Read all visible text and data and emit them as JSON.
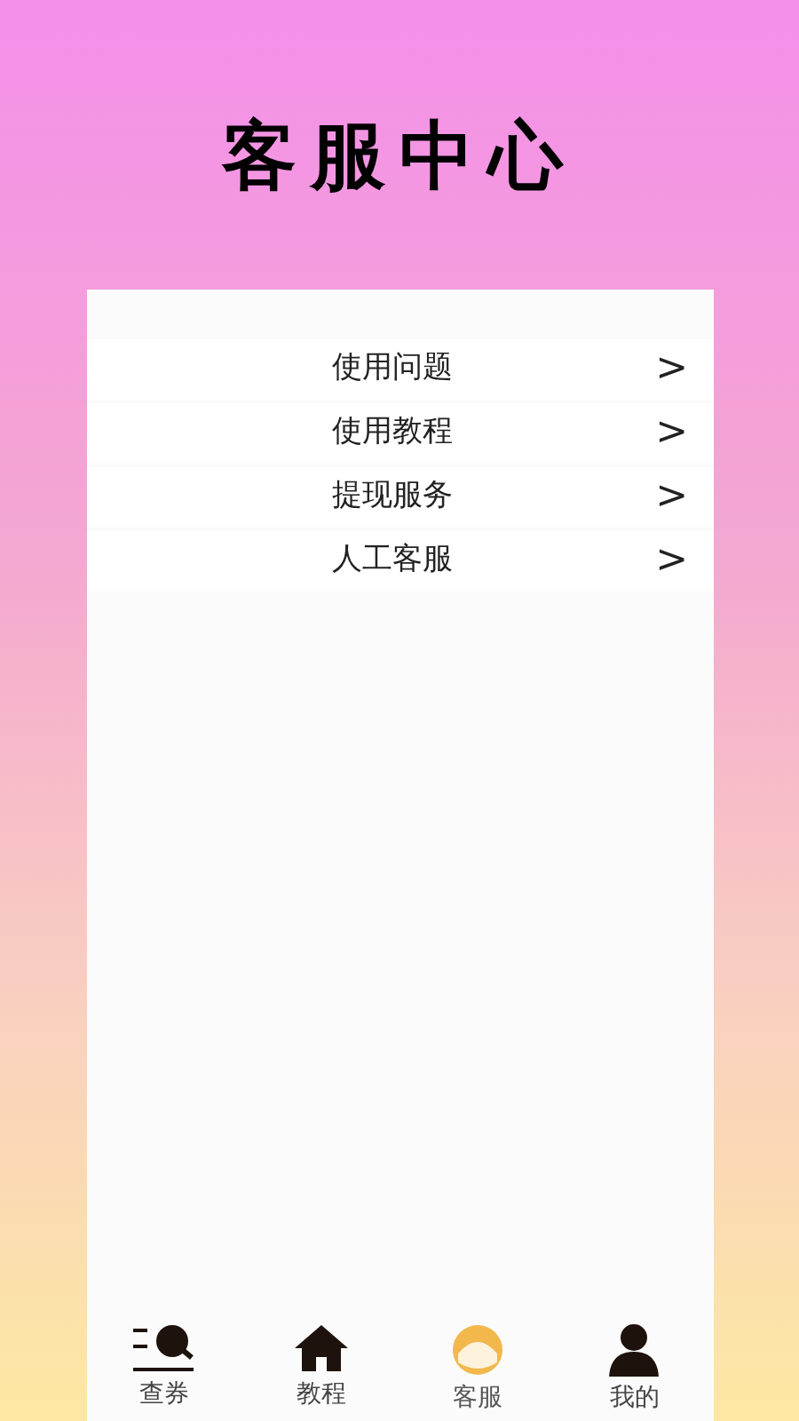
{
  "title": "客服中心",
  "menu": [
    {
      "label": "使用问题",
      "chevron": ">"
    },
    {
      "label": "使用教程",
      "chevron": ">"
    },
    {
      "label": "提现服务",
      "chevron": ">"
    },
    {
      "label": "人工客服",
      "chevron": ">"
    }
  ],
  "nav": [
    {
      "label": "查券",
      "kind": "search",
      "selected": false
    },
    {
      "label": "教程",
      "kind": "home",
      "selected": false
    },
    {
      "label": "客服",
      "kind": "service",
      "selected": true
    },
    {
      "label": "我的",
      "kind": "user",
      "selected": false
    }
  ]
}
